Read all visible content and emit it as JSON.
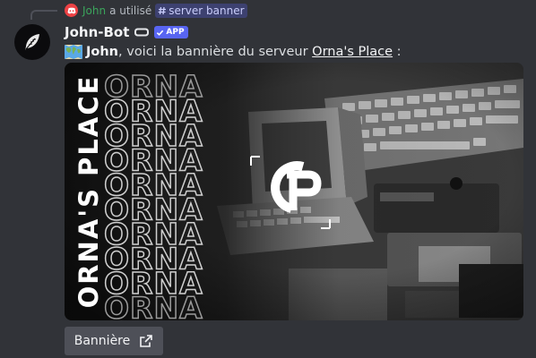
{
  "command_reply": {
    "user": "John",
    "used_text": "a utilisé",
    "command_name": "server banner"
  },
  "author": {
    "name": "John-Bot",
    "app_tag": "APP"
  },
  "message": {
    "mention": "John",
    "text_before_link": ", voici la bannière du serveur ",
    "server_link": "Orna's Place",
    "text_after_link": " :"
  },
  "banner": {
    "vertical_title": "ORNA'S PLACE",
    "repeated_word": "ORNA",
    "repeat_count": 10,
    "logo_monogram": "OP"
  },
  "button": {
    "label": "Bannière",
    "icon": "external-link-icon"
  },
  "colors": {
    "background": "#313338",
    "app_tag": "#5865f2",
    "command_user": "#3ba55c",
    "button": "#4e5058"
  }
}
